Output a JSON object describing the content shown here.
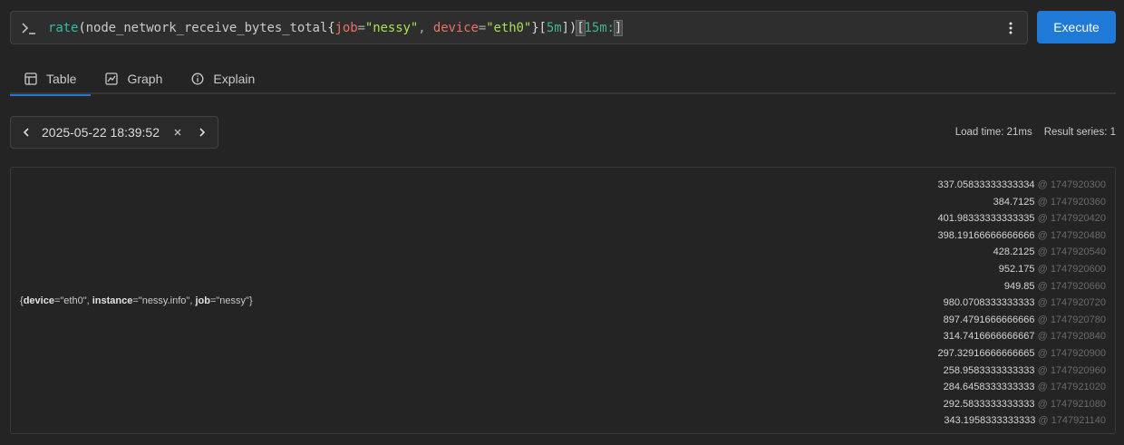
{
  "query": {
    "fn": "rate",
    "metric": "node_network_receive_bytes_total",
    "label1_key": "job",
    "label1_val": "\"nessy\"",
    "label2_key": "device",
    "label2_val": "\"eth0\"",
    "range": "5m",
    "subquery": "15m:"
  },
  "execute_label": "Execute",
  "tabs": [
    {
      "label": "Table",
      "icon": "table-icon"
    },
    {
      "label": "Graph",
      "icon": "graph-icon"
    },
    {
      "label": "Explain",
      "icon": "info-icon"
    }
  ],
  "time_picker": {
    "value": "2025-05-22 18:39:52"
  },
  "stats": {
    "load_time": "Load time: 21ms",
    "result_series": "Result series: 1"
  },
  "series": {
    "k1": "device",
    "v1": "\"eth0\"",
    "k2": "instance",
    "v2": "\"nessy.info\"",
    "k3": "job",
    "v3": "\"nessy\""
  },
  "values": [
    {
      "v": "337.05833333333334",
      "t": "@ 1747920300"
    },
    {
      "v": "384.7125",
      "t": "@ 1747920360"
    },
    {
      "v": "401.98333333333335",
      "t": "@ 1747920420"
    },
    {
      "v": "398.19166666666666",
      "t": "@ 1747920480"
    },
    {
      "v": "428.2125",
      "t": "@ 1747920540"
    },
    {
      "v": "952.175",
      "t": "@ 1747920600"
    },
    {
      "v": "949.85",
      "t": "@ 1747920660"
    },
    {
      "v": "980.0708333333333",
      "t": "@ 1747920720"
    },
    {
      "v": "897.4791666666666",
      "t": "@ 1747920780"
    },
    {
      "v": "314.7416666666667",
      "t": "@ 1747920840"
    },
    {
      "v": "297.32916666666665",
      "t": "@ 1747920900"
    },
    {
      "v": "258.9583333333333",
      "t": "@ 1747920960"
    },
    {
      "v": "284.6458333333333",
      "t": "@ 1747921020"
    },
    {
      "v": "292.5833333333333",
      "t": "@ 1747921080"
    },
    {
      "v": "343.1958333333333",
      "t": "@ 1747921140"
    }
  ]
}
